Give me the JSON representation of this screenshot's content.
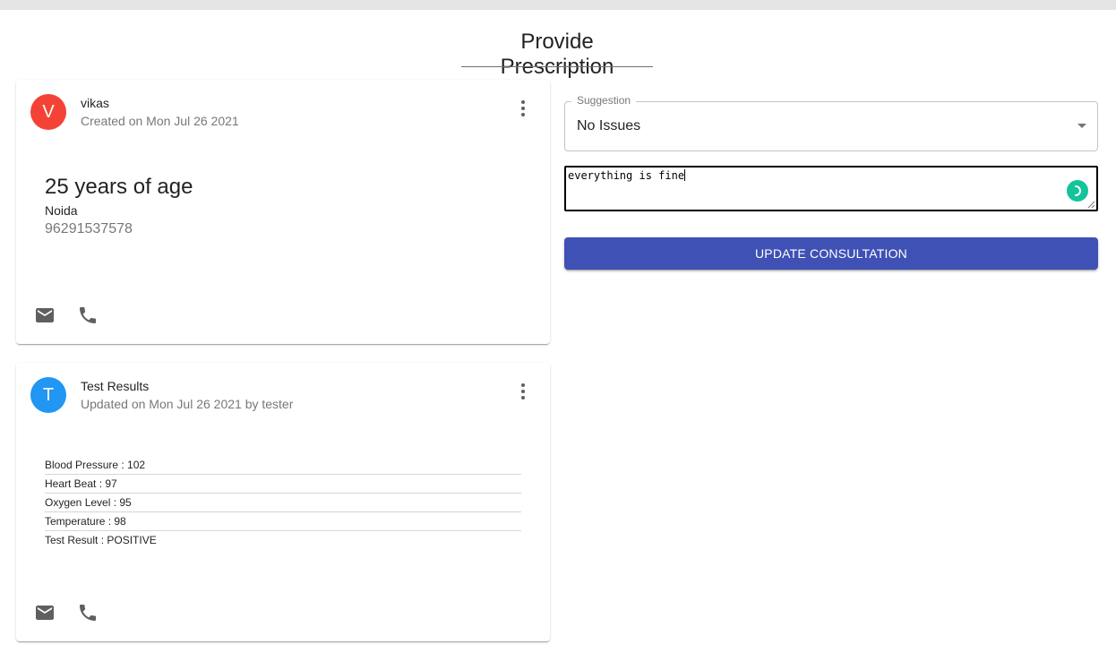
{
  "page": {
    "title": "Provide Prescription"
  },
  "patient_card": {
    "avatar_letter": "V",
    "avatar_color": "#f44336",
    "name": "vikas",
    "created": "Created on Mon Jul 26 2021",
    "age": "25 years of age",
    "city": "Noida",
    "phone": "96291537578",
    "actions": [
      "mail-icon",
      "phone-icon"
    ]
  },
  "results_card": {
    "avatar_letter": "T",
    "avatar_color": "#2196f3",
    "title": "Test Results",
    "updated": "Updated on Mon Jul 26 2021 by tester",
    "rows": [
      "Blood Pressure : 102",
      "Heart Beat : 97",
      "Oxygen Level : 95",
      "Temperature : 98",
      "Test Result : POSITIVE"
    ],
    "actions": [
      "mail-icon",
      "phone-icon"
    ]
  },
  "form": {
    "suggestion_label": "Suggestion",
    "suggestion_value": "No Issues",
    "notes_value": "everything is fine",
    "submit_label": "UPDATE CONSULTATION",
    "primary_color": "#3f51b5"
  }
}
